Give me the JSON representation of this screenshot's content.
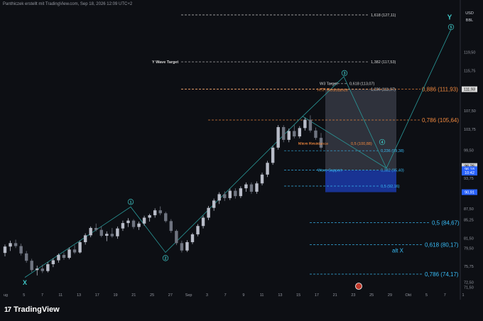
{
  "header": {
    "caption": "Panthiczek erstellt mit TradingView.com, Sep 18, 2026 12:09 UTC+2"
  },
  "currency": {
    "line1": "USD",
    "line2": "BBL"
  },
  "brand": {
    "logo": "17",
    "name": "TradingView"
  },
  "colors": {
    "background": "#0d0f14",
    "bull": "#b8bcc8",
    "bear": "#6f7480",
    "wave_line": "#2a9a9a",
    "wave_label": "#3fc6c6",
    "orange": "#f0883e",
    "white_dash": "#d9d9d9",
    "cyan_dash": "#38bdf8",
    "blue_zone": "#1c3aa9",
    "gray_zone": "#3b3f4a"
  },
  "chart_data": {
    "type": "candlestick",
    "y_axis": {
      "range": [
        71,
        127.5
      ],
      "ticks": [
        "119,50",
        "115,75",
        "111,93",
        "107,50",
        "103,75",
        "99,50",
        "96,26",
        "96,18",
        "93,75",
        "90,91",
        "87,50",
        "85,25",
        "81,50",
        "79,50",
        "75,75",
        "72,50",
        "71,50"
      ],
      "tick_values": [
        119.5,
        115.75,
        111.93,
        107.5,
        103.75,
        99.5,
        96.26,
        96.18,
        93.75,
        90.91,
        87.5,
        85.25,
        81.5,
        79.5,
        75.75,
        72.5,
        71.5
      ],
      "badges": [
        {
          "value": 111.93,
          "text": "111,93",
          "bg": "#d9d9d9",
          "fg": "#000000"
        },
        {
          "value": 96.26,
          "text": "96,26",
          "bg": "#cccccc",
          "fg": "#000000"
        },
        {
          "value": 95.6,
          "text": "96,18",
          "bg": "#2962ff",
          "fg": "#ffffff"
        },
        {
          "value": 94.9,
          "text": "10:42",
          "bg": "#2962ff",
          "fg": "#ffffff"
        },
        {
          "value": 90.91,
          "text": "90,91",
          "bg": "#2962ff",
          "fg": "#ffffff"
        }
      ]
    },
    "x_axis": {
      "labels": [
        "ug",
        "5",
        "7",
        "11",
        "13",
        "17",
        "19",
        "21",
        "25",
        "27",
        "Sep",
        "3",
        "7",
        "9",
        "11",
        "13",
        "15",
        "17",
        "21",
        "23",
        "25",
        "29",
        "Okt",
        "5",
        "7",
        "1"
      ]
    },
    "candles": [
      [
        78.5,
        80.2,
        77.8,
        79.8
      ],
      [
        79.8,
        81.0,
        78.9,
        80.5
      ],
      [
        80.5,
        81.2,
        79.5,
        79.9
      ],
      [
        79.9,
        80.4,
        78.0,
        78.4
      ],
      [
        78.4,
        78.9,
        76.5,
        76.9
      ],
      [
        76.9,
        77.3,
        74.6,
        75.0
      ],
      [
        75.0,
        75.9,
        73.9,
        75.3
      ],
      [
        75.3,
        76.1,
        74.4,
        74.8
      ],
      [
        74.8,
        76.6,
        74.5,
        76.2
      ],
      [
        76.2,
        77.4,
        75.6,
        77.0
      ],
      [
        77.0,
        78.4,
        76.5,
        78.1
      ],
      [
        78.1,
        78.6,
        77.1,
        77.5
      ],
      [
        77.5,
        79.6,
        77.2,
        79.2
      ],
      [
        79.2,
        80.1,
        78.3,
        78.6
      ],
      [
        78.6,
        81.0,
        78.4,
        80.7
      ],
      [
        80.7,
        82.5,
        80.2,
        82.1
      ],
      [
        82.1,
        83.9,
        81.7,
        83.6
      ],
      [
        83.6,
        84.5,
        82.9,
        83.2
      ],
      [
        83.2,
        83.9,
        81.7,
        82.0
      ],
      [
        82.0,
        82.9,
        80.9,
        82.4
      ],
      [
        82.4,
        83.6,
        81.6,
        81.9
      ],
      [
        81.9,
        83.9,
        81.4,
        83.5
      ],
      [
        83.5,
        85.1,
        83.0,
        84.6
      ],
      [
        84.6,
        85.6,
        83.8,
        85.1
      ],
      [
        85.1,
        85.4,
        83.4,
        83.8
      ],
      [
        83.8,
        84.9,
        83.2,
        84.5
      ],
      [
        84.5,
        86.1,
        84.1,
        85.7
      ],
      [
        85.7,
        86.5,
        84.9,
        86.2
      ],
      [
        86.2,
        87.6,
        85.7,
        87.2
      ],
      [
        87.2,
        88.0,
        86.2,
        86.6
      ],
      [
        86.6,
        86.9,
        84.7,
        85.0
      ],
      [
        85.0,
        85.4,
        82.6,
        83.0
      ],
      [
        83.0,
        83.3,
        80.1,
        80.5
      ],
      [
        80.5,
        81.0,
        78.6,
        79.0
      ],
      [
        79.0,
        81.1,
        78.7,
        80.7
      ],
      [
        80.7,
        82.6,
        80.3,
        82.3
      ],
      [
        82.3,
        84.4,
        81.9,
        84.0
      ],
      [
        84.0,
        86.1,
        83.5,
        85.7
      ],
      [
        85.7,
        88.1,
        85.2,
        87.7
      ],
      [
        87.7,
        89.6,
        87.1,
        89.2
      ],
      [
        89.2,
        90.9,
        88.5,
        90.5
      ],
      [
        90.5,
        91.1,
        89.1,
        89.7
      ],
      [
        89.7,
        91.6,
        89.3,
        91.2
      ],
      [
        91.2,
        91.7,
        89.6,
        90.1
      ],
      [
        90.1,
        92.1,
        89.7,
        91.7
      ],
      [
        91.7,
        92.9,
        91.0,
        92.5
      ],
      [
        92.5,
        92.9,
        90.6,
        91.0
      ],
      [
        91.0,
        93.1,
        90.6,
        92.7
      ],
      [
        92.7,
        94.9,
        92.3,
        94.5
      ],
      [
        94.5,
        97.3,
        94.0,
        96.9
      ],
      [
        96.9,
        100.4,
        96.5,
        100.0
      ],
      [
        100.0,
        104.6,
        99.6,
        104.2
      ],
      [
        104.2,
        104.6,
        101.1,
        101.6
      ],
      [
        101.6,
        103.9,
        101.1,
        103.4
      ],
      [
        103.4,
        104.6,
        101.9,
        102.3
      ],
      [
        102.3,
        104.4,
        101.9,
        104.0
      ],
      [
        104.0,
        106.1,
        103.5,
        105.7
      ],
      [
        105.7,
        106.6,
        103.1,
        103.5
      ],
      [
        103.5,
        104.1,
        101.6,
        102.0
      ],
      [
        102.0,
        103.0,
        99.6,
        100.0
      ]
    ],
    "fib_levels": [
      {
        "label": "1,618 (127,11)",
        "value": 127.11,
        "color": "white"
      },
      {
        "label": "1,382 (117,53)",
        "value": 117.53,
        "color": "white"
      },
      {
        "label": "0,618 (113,07)",
        "value": 113.07,
        "color": "white"
      },
      {
        "label": "1,236 (111,97)",
        "value": 111.97,
        "color": "white"
      },
      {
        "label": "0,886 (111,93)",
        "value": 111.93,
        "color": "orange"
      },
      {
        "label": "0,786 (105,64)",
        "value": 105.64,
        "color": "orange"
      },
      {
        "label": "0,5 (100,88)",
        "value": 100.88,
        "color": "orange"
      },
      {
        "label": "0,236 (99,38)",
        "value": 99.38,
        "color": "cyan"
      },
      {
        "label": "0,382 (95,40)",
        "value": 95.4,
        "color": "cyan"
      },
      {
        "label": "0,5 (92,16)",
        "value": 92.16,
        "color": "cyan"
      },
      {
        "label": "0,5 (84,67)",
        "value": 84.67,
        "color": "cyan"
      },
      {
        "label": "0,618 (80,17)",
        "value": 80.17,
        "color": "cyan"
      },
      {
        "label": "0,786 (74,17)",
        "value": 74.17,
        "color": "cyan"
      }
    ],
    "annotations": [
      {
        "text": "Y Wave Target",
        "color": "white"
      },
      {
        "text": "W3 Target",
        "color": "white"
      },
      {
        "text": "HTF Resistance",
        "color": "orange"
      },
      {
        "text": "Micro Resistance",
        "color": "orange"
      },
      {
        "text": "Wave Support",
        "color": "cyan"
      },
      {
        "text": "alt X",
        "color": "cyan"
      }
    ],
    "wave_labels": [
      "X",
      "1",
      "2",
      "3",
      "4",
      "5",
      "Y"
    ],
    "grid": false,
    "log_scale": false
  }
}
